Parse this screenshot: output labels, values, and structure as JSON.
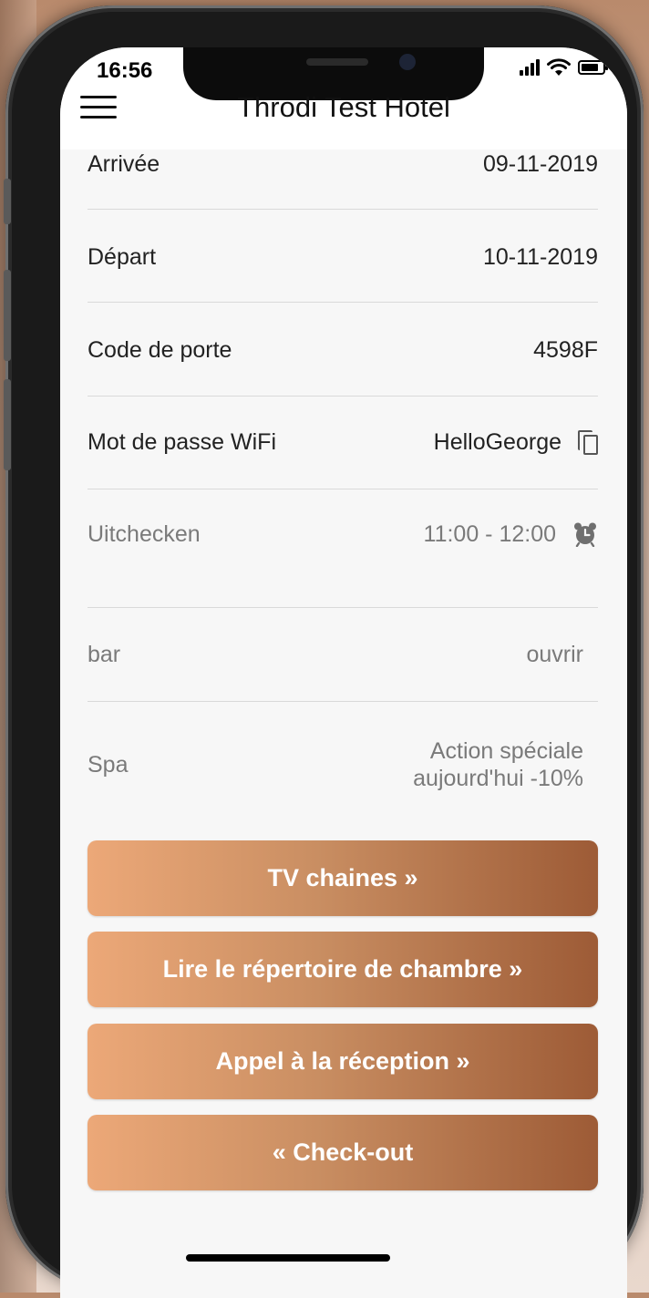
{
  "status_bar": {
    "time": "16:56"
  },
  "header": {
    "title": "Throdi Test Hotel"
  },
  "info_rows": [
    {
      "label": "Arrivée",
      "value": "09-11-2019"
    },
    {
      "label": "Départ",
      "value": "10-11-2019"
    },
    {
      "label": "Code de porte",
      "value": "4598F"
    },
    {
      "label": "Mot de passe WiFi",
      "value": "HelloGeorge",
      "icon": "copy-icon"
    },
    {
      "label": "Uitchecken",
      "value": "11:00 - 12:00",
      "icon": "alarm-clock-icon"
    },
    {
      "label": "bar",
      "value": "ouvrir"
    },
    {
      "label": "Spa",
      "value_line1": "Action spéciale",
      "value_line2": "aujourd'hui -10%"
    }
  ],
  "buttons": {
    "tv": "TV chaines »",
    "directory": "Lire le répertoire de chambre »",
    "reception": "Appel à la réception »",
    "checkout": "« Check-out"
  },
  "colors": {
    "button_gradient_start": "#eca878",
    "button_gradient_end": "#9d5b36",
    "screen_background": "#f7f7f7"
  }
}
